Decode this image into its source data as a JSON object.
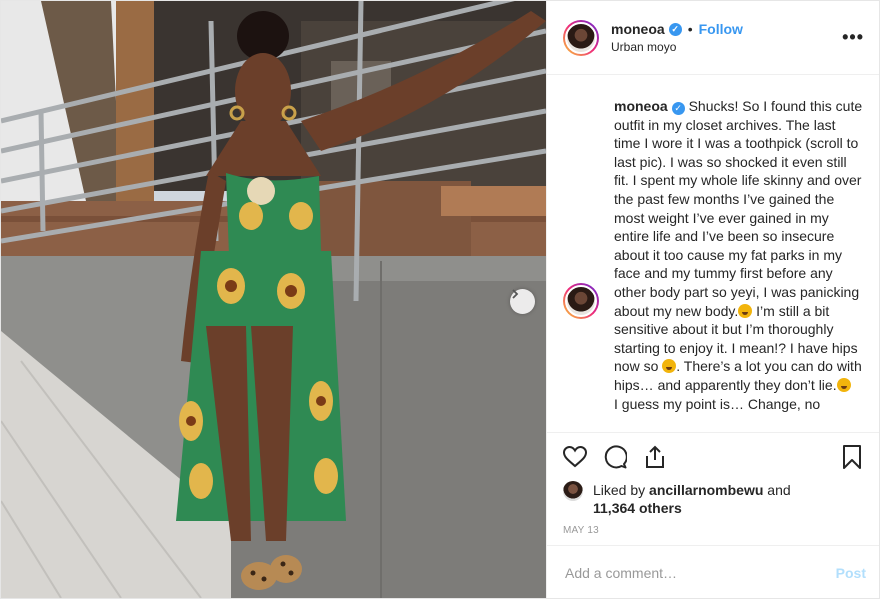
{
  "post": {
    "username": "moneoa",
    "verified": true,
    "separator": "•",
    "follow_label": "Follow",
    "location": "Urban moyo",
    "more_options_label": "•••",
    "caption_username": "moneoa",
    "caption_part1": " Shucks! So I found this cute outfit in my closet archives. The last time I wore it I was a toothpick (scroll to last pic). I was so shocked it even still fit. I spent my whole life skinny and over the past few months I’ve gained the most weight I’ve ever gained in my entire life and I’ve been so insecure about it too cause my fat parks in my face and my tummy first before any other body part so yeyi, I was panicking about my new body.",
    "caption_part2": " I’m still a bit sensitive about it but I’m thoroughly starting to enjoy it. I mean!? I have hips now so ",
    "caption_part3": ". There’s a lot you can do with hips… and apparently they don’t lie.",
    "caption_part4": "I guess my point is… Change, no",
    "likes": {
      "prefix": "Liked by ",
      "liker": "ancillarnombewu",
      "and": " and",
      "count": "11,364 others"
    },
    "date": "MAY 13",
    "comment_placeholder": "Add a comment…",
    "post_button": "Post"
  },
  "colors": {
    "link_blue": "#3897f0",
    "post_disabled": "#b2dffc",
    "border": "#efefef",
    "muted": "#999999"
  },
  "icons": {
    "like": "heart-icon",
    "comment": "comment-bubble-icon",
    "share": "share-icon",
    "save": "bookmark-icon",
    "verified": "verified-badge-icon",
    "carousel": "chevron-right-icon"
  }
}
